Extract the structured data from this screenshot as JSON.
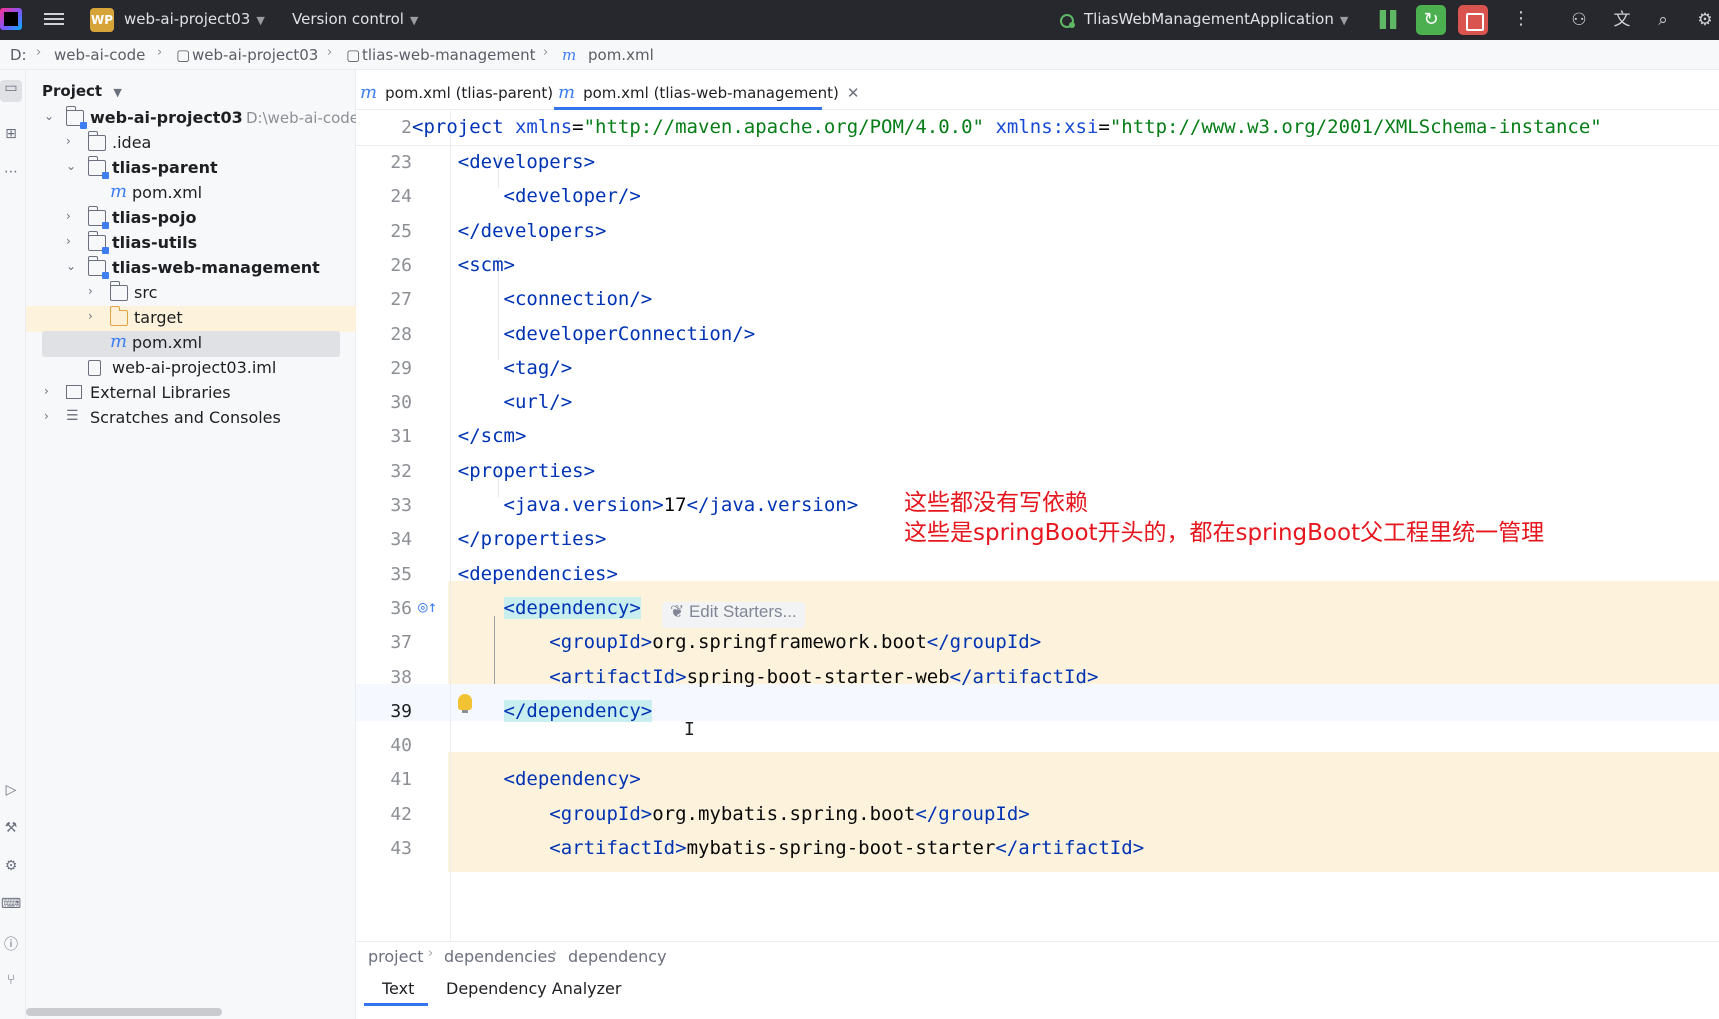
{
  "titlebar": {
    "project_badge": "WP",
    "project_name": "web-ai-project03",
    "version_control": "Version control",
    "run_config": "TliasWebManagementApplication"
  },
  "breadcrumb": [
    "D:",
    "web-ai-code",
    "web-ai-project03",
    "tlias-web-management",
    "pom.xml"
  ],
  "project_panel": {
    "header": "Project",
    "tree": [
      {
        "label": "web-ai-project03",
        "suffix": "D:\\web-ai-code",
        "bold": true
      },
      {
        "label": ".idea"
      },
      {
        "label": "tlias-parent",
        "bold": true
      },
      {
        "label": "pom.xml"
      },
      {
        "label": "tlias-pojo",
        "bold": true
      },
      {
        "label": "tlias-utils",
        "bold": true
      },
      {
        "label": "tlias-web-management",
        "bold": true
      },
      {
        "label": "src"
      },
      {
        "label": "target"
      },
      {
        "label": "pom.xml"
      },
      {
        "label": "web-ai-project03.iml"
      },
      {
        "label": "External Libraries"
      },
      {
        "label": "Scratches and Consoles"
      }
    ]
  },
  "editor_tabs": [
    {
      "label": "pom.xml (tlias-parent)",
      "active": false
    },
    {
      "label": "pom.xml (tlias-web-management)",
      "active": true
    }
  ],
  "code": {
    "header_line": {
      "number": "2",
      "parts": [
        {
          "t": "tag",
          "s": "<project "
        },
        {
          "t": "attr",
          "s": "xmlns"
        },
        {
          "t": "plain",
          "s": "="
        },
        {
          "t": "str",
          "s": "\"http://maven.apache.org/POM/4.0.0\""
        },
        {
          "t": "plain",
          "s": " "
        },
        {
          "t": "attr",
          "s": "xmlns:xsi"
        },
        {
          "t": "plain",
          "s": "="
        },
        {
          "t": "str",
          "s": "\"http://www.w3.org/2001/XMLSchema-instance\""
        }
      ]
    },
    "lines": [
      {
        "n": "23",
        "text": "    <developers>"
      },
      {
        "n": "24",
        "text": "        <developer/>"
      },
      {
        "n": "25",
        "text": "    </developers>"
      },
      {
        "n": "26",
        "text": "    <scm>"
      },
      {
        "n": "27",
        "text": "        <connection/>"
      },
      {
        "n": "28",
        "text": "        <developerConnection/>"
      },
      {
        "n": "29",
        "text": "        <tag/>"
      },
      {
        "n": "30",
        "text": "        <url/>"
      },
      {
        "n": "31",
        "text": "    </scm>"
      },
      {
        "n": "32",
        "text": "    <properties>"
      },
      {
        "n": "33",
        "text": "        <java.version>17</java.version>"
      },
      {
        "n": "34",
        "text": "    </properties>"
      },
      {
        "n": "35",
        "text": "    <dependencies>"
      },
      {
        "n": "36",
        "text": "        <dependency>"
      },
      {
        "n": "37",
        "text": "            <groupId>org.springframework.boot</groupId>"
      },
      {
        "n": "38",
        "text": "            <artifactId>spring-boot-starter-web</artifactId>"
      },
      {
        "n": "39",
        "text": "        </dependency>"
      },
      {
        "n": "40",
        "text": ""
      },
      {
        "n": "41",
        "text": "        <dependency>"
      },
      {
        "n": "42",
        "text": "            <groupId>org.mybatis.spring.boot</groupId>"
      },
      {
        "n": "43",
        "text": "            <artifactId>mybatis-spring-boot-starter</artifactId>"
      }
    ],
    "inlay_hint": "Edit Starters..."
  },
  "annotation": {
    "line1": "这些都没有写依赖",
    "line2": "这些是springBoot开头的，都在springBoot父工程里统一管理"
  },
  "xml_path": [
    "project",
    "dependencies",
    "dependency"
  ],
  "bottom_tabs": [
    {
      "label": "Text",
      "active": true
    },
    {
      "label": "Dependency Analyzer",
      "active": false
    }
  ],
  "colors": {
    "tag": "#0033b3",
    "string": "#067d17",
    "highlight_block": "#fdf3dc",
    "annotation": "#e5161d",
    "accent": "#3574f0"
  }
}
